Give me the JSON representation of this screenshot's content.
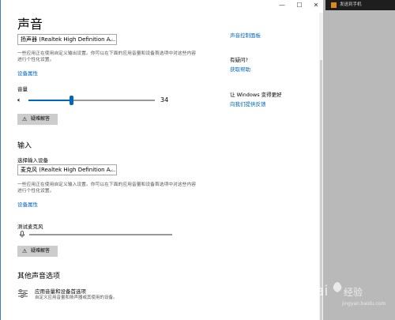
{
  "window": {
    "controls": {
      "minimize": "—",
      "maximize": "☐",
      "close": "✕"
    }
  },
  "page": {
    "title": "声音"
  },
  "output": {
    "device_dropdown": "扬声器 (Realtek High Definition A...",
    "description": "一些应用正在使用自定义输出设置。你可以在下面的应用音量和设备首选项中对这些内容进行个性化设置。",
    "device_properties_link": "设备属性",
    "volume_label": "音量",
    "volume_value": "34",
    "volume_fraction": 0.34,
    "troubleshoot_button": "疑难解答"
  },
  "input": {
    "section_title": "输入",
    "choose_label": "选择输入设备",
    "device_dropdown": "麦克风 (Realtek High Definition A...",
    "description": "一些应用正在使用自定义输入设置。你可以在下面的应用音量和设备首选项中对这些内容进行个性化设置。",
    "device_properties_link": "设备属性",
    "test_mic_label": "测试麦克风",
    "troubleshoot_button": "疑难解答"
  },
  "other": {
    "section_title": "其他声音选项",
    "app_volume_title": "应用音量和设备首选项",
    "app_volume_desc": "自定义应用音量和扬声器或其使用的设备。"
  },
  "right_panel": {
    "top_link": "声音控制面板",
    "question_label": "有疑问?",
    "get_help_link": "获取帮助",
    "improve_label": "让 Windows 变得更好",
    "feedback_link": "向我们提供反馈"
  },
  "taskbar": {
    "item_label": "发送到手机"
  },
  "colors": {
    "accent": "#0067c0",
    "button_bg": "#cccccc"
  }
}
